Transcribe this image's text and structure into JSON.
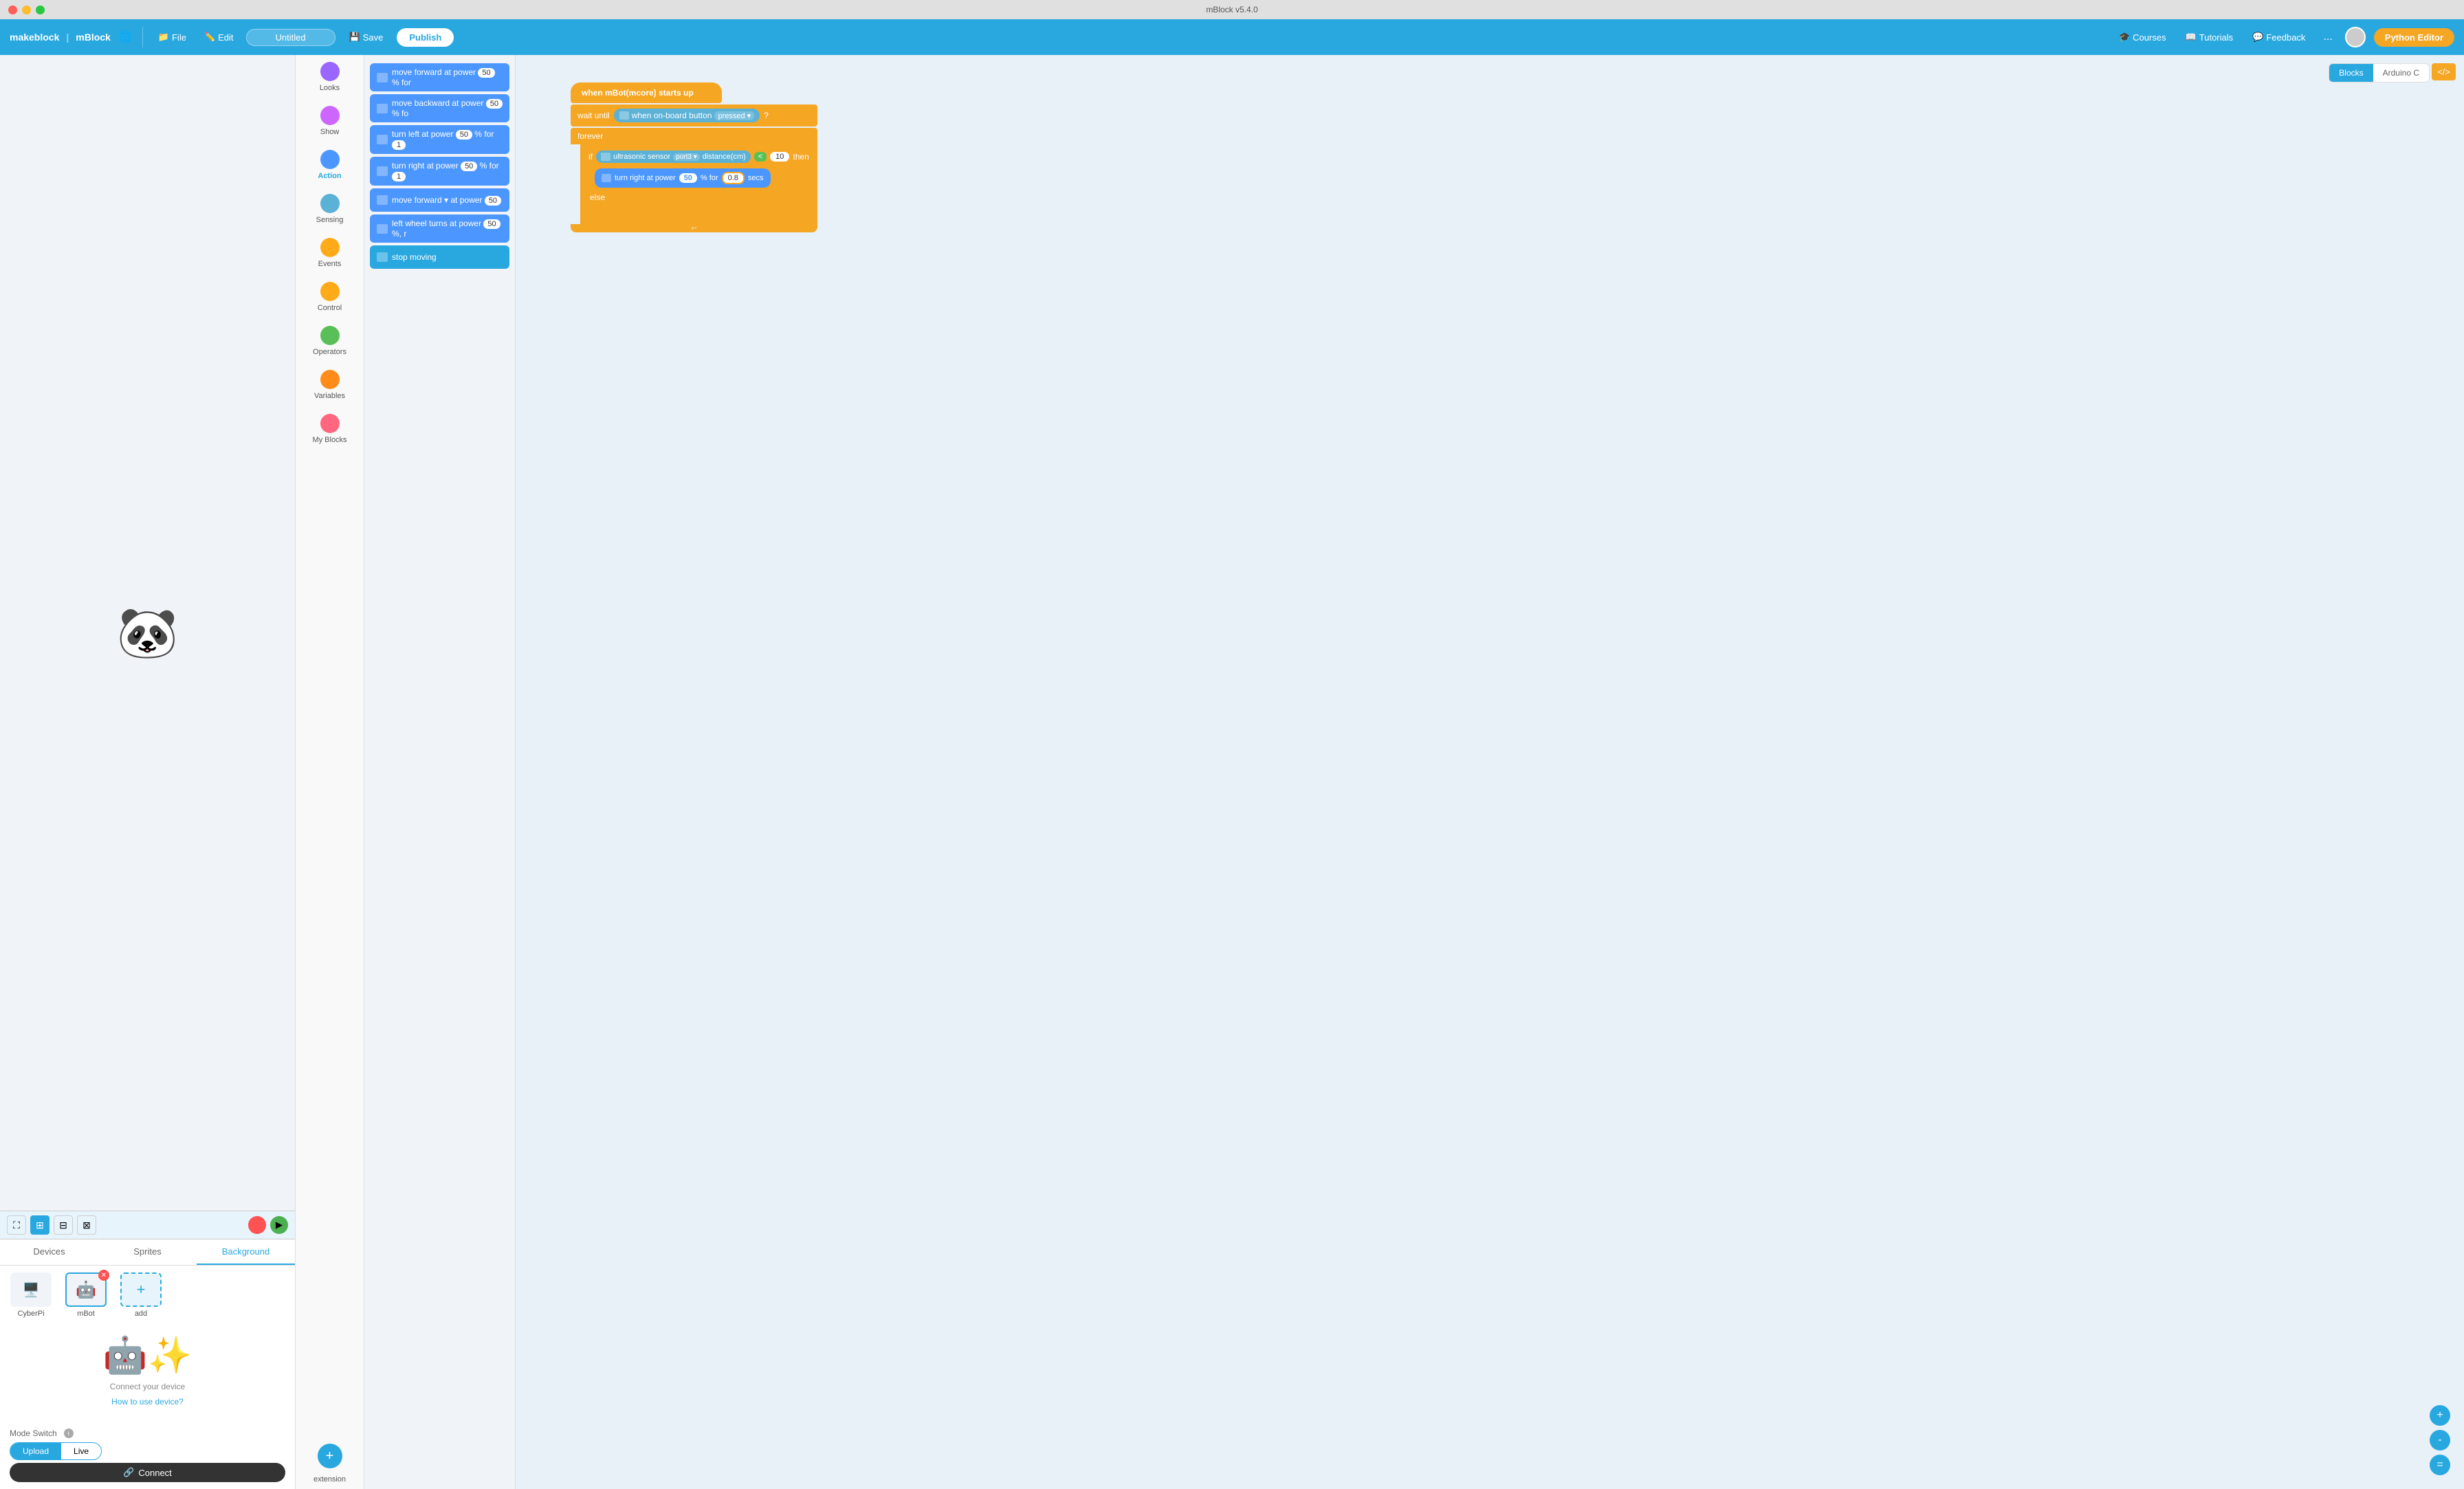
{
  "app": {
    "title": "mBlock v5.4.0",
    "window_controls": [
      "close",
      "minimize",
      "maximize"
    ]
  },
  "toolbar": {
    "logo": "makeblock | mBlock",
    "file_label": "File",
    "edit_label": "Edit",
    "title": "Untitled",
    "save_label": "Save",
    "publish_label": "Publish",
    "courses_label": "Courses",
    "tutorials_label": "Tutorials",
    "feedback_label": "Feedback",
    "more_label": "...",
    "python_editor_label": "Python Editor"
  },
  "code_tabs": {
    "blocks_label": "Blocks",
    "arduino_label": "Arduino C"
  },
  "block_categories": [
    {
      "id": "looks",
      "label": "Looks",
      "color": "#9966ff"
    },
    {
      "id": "show",
      "label": "Show",
      "color": "#cc66ff"
    },
    {
      "id": "action",
      "label": "Action",
      "color": "#4c97ff"
    },
    {
      "id": "sensing",
      "label": "Sensing",
      "color": "#5cb1d6"
    },
    {
      "id": "events",
      "label": "Events",
      "color": "#ffab19"
    },
    {
      "id": "control",
      "label": "Control",
      "color": "#ffab19"
    },
    {
      "id": "operators",
      "label": "Operators",
      "color": "#59c059"
    },
    {
      "id": "variables",
      "label": "Variables",
      "color": "#ff8c1a"
    },
    {
      "id": "myblocks",
      "label": "My Blocks",
      "color": "#ff6680"
    }
  ],
  "blocks_list": [
    {
      "label": "move forward at power 50 % for",
      "color": "blue"
    },
    {
      "label": "move backward at power 50 % fo",
      "color": "blue"
    },
    {
      "label": "turn left at power 50 % for 1",
      "color": "blue"
    },
    {
      "label": "turn right at power 50 % for 1",
      "color": "blue"
    },
    {
      "label": "move forward ▾ at power 50",
      "color": "blue"
    },
    {
      "label": "left wheel turns at power 50 %, r",
      "color": "blue"
    },
    {
      "label": "stop moving",
      "color": "teal"
    }
  ],
  "code_blocks": {
    "when_start": "when mBot(mcore) starts up",
    "wait_until": "wait until",
    "when_onboard": "when on-board button",
    "pressed": "pressed ▾",
    "question": "?",
    "forever": "forever",
    "if_label": "if",
    "then_label": "then",
    "else_label": "else",
    "ultrasonic": "ultrasonic sensor",
    "port3": "port3 ▾",
    "distance": "distance(cm)",
    "less_than": "<",
    "distance_val": "10",
    "turn_right": "turn right at power",
    "power_val": "50",
    "percent": "% for",
    "time_val": "0.8",
    "secs": "secs"
  },
  "tabs": {
    "devices": "Devices",
    "sprites": "Sprites",
    "background": "Background"
  },
  "devices": [
    {
      "id": "cyberpi",
      "label": "CyberPi",
      "icon": "🖥"
    },
    {
      "id": "mbot",
      "label": "mBot",
      "icon": "🤖",
      "active": true
    }
  ],
  "device_panel": {
    "connect_label": "Connect your device",
    "how_to": "How to use device?",
    "mode_switch": "Mode Switch",
    "upload_label": "Upload",
    "live_label": "Live",
    "connect_btn": "Connect"
  },
  "zoom_controls": {
    "zoom_in": "+",
    "zoom_out": "-",
    "reset": "="
  },
  "extension": {
    "label": "extension"
  }
}
